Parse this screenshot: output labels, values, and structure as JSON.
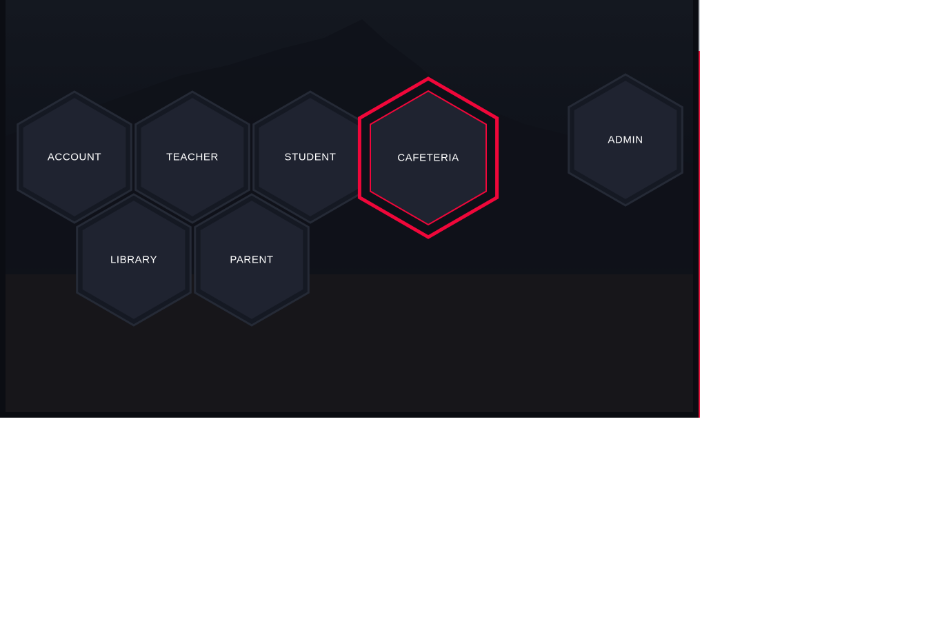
{
  "tiles": [
    {
      "id": "account",
      "label": "ACCOUNT",
      "active": false
    },
    {
      "id": "teacher",
      "label": "TEACHER",
      "active": false
    },
    {
      "id": "student",
      "label": "STUDENT",
      "active": false
    },
    {
      "id": "cafeteria",
      "label": "CAFETERIA",
      "active": true
    },
    {
      "id": "admin",
      "label": "ADMIN",
      "active": false
    },
    {
      "id": "library",
      "label": "LIBRARY",
      "active": false
    },
    {
      "id": "parent",
      "label": "PARENT",
      "active": false
    }
  ],
  "colors": {
    "background": "#0d1018",
    "hex_fill": "#1f2330",
    "hex_border": "#151923",
    "hex_outer_ring": "#252a36",
    "accent": "#f0073a",
    "label_text": "#ffffff",
    "page_outside": "#ffffff"
  }
}
